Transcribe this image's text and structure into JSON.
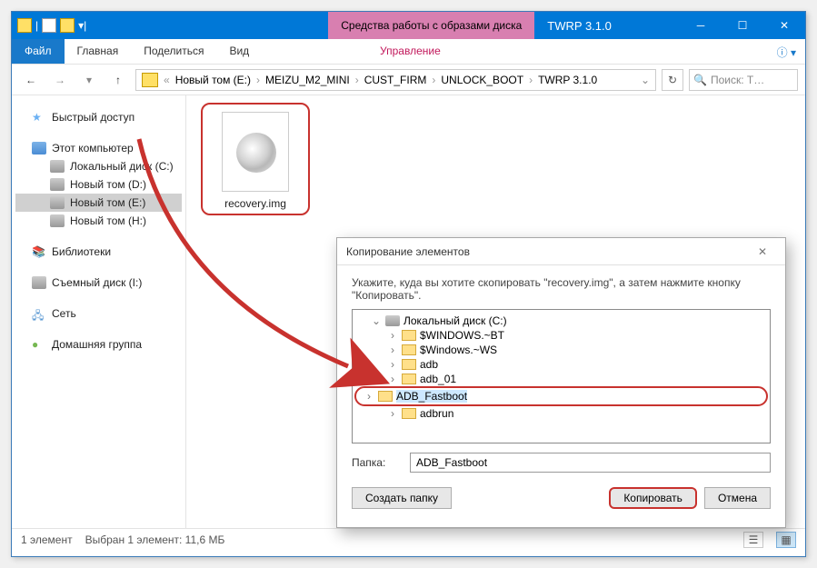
{
  "titlebar": {
    "context_tab": "Средства работы с образами диска",
    "title": "TWRP 3.1.0"
  },
  "ribbon": {
    "file": "Файл",
    "home": "Главная",
    "share": "Поделиться",
    "view": "Вид",
    "manage": "Управление"
  },
  "breadcrumbs": {
    "items": [
      "Новый том (E:)",
      "MEIZU_M2_MINI",
      "CUST_FIRM",
      "UNLOCK_BOOT",
      "TWRP 3.1.0"
    ]
  },
  "search": {
    "placeholder": "Поиск: T…"
  },
  "nav": {
    "quick": "Быстрый доступ",
    "pc": "Этот компьютер",
    "drive_c": "Локальный диск (C:)",
    "drive_d": "Новый том (D:)",
    "drive_e": "Новый том (E:)",
    "drive_h": "Новый том (H:)",
    "libs": "Библиотеки",
    "removable": "Съемный диск (I:)",
    "network": "Сеть",
    "homegroup": "Домашняя группа"
  },
  "file": {
    "name": "recovery.img"
  },
  "status": {
    "count": "1 элемент",
    "selection": "Выбран 1 элемент: 11,6 МБ"
  },
  "dialog": {
    "title": "Копирование элементов",
    "instruction": "Укажите, куда вы хотите скопировать \"recovery.img\", а затем нажмите кнопку \"Копировать\".",
    "tree": {
      "root": "Локальный диск (C:)",
      "items": [
        "$WINDOWS.~BT",
        "$Windows.~WS",
        "adb",
        "adb_01",
        "ADB_Fastboot",
        "adbrun"
      ]
    },
    "folder_label": "Папка:",
    "folder_value": "ADB_Fastboot",
    "btn_newfolder": "Создать папку",
    "btn_copy": "Копировать",
    "btn_cancel": "Отмена"
  }
}
